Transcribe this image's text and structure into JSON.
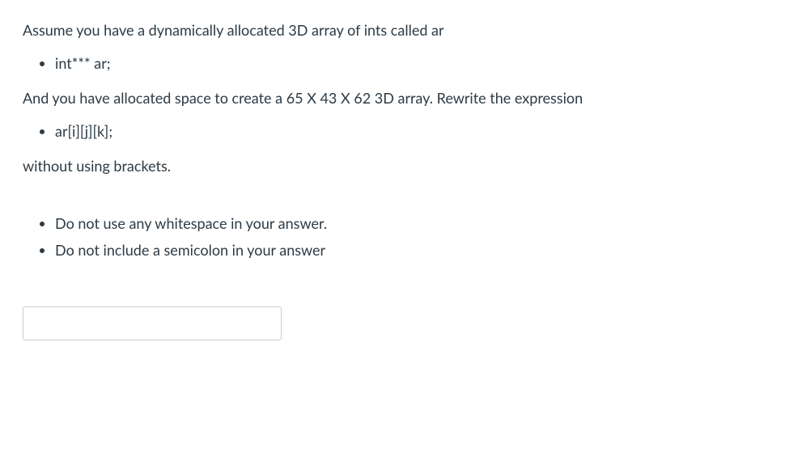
{
  "question": {
    "intro": "Assume you have a dynamically allocated 3D array of ints called ar",
    "declaration": "int*** ar;",
    "allocation": "And you have allocated space to create a 65 X 43 X 62 3D array. Rewrite the expression",
    "expression": "ar[i][j][k];",
    "task": "without using brackets.",
    "rules": [
      "Do not use any whitespace in your answer.",
      "Do not include a semicolon in your answer"
    ]
  },
  "answer": {
    "value": "",
    "placeholder": ""
  }
}
